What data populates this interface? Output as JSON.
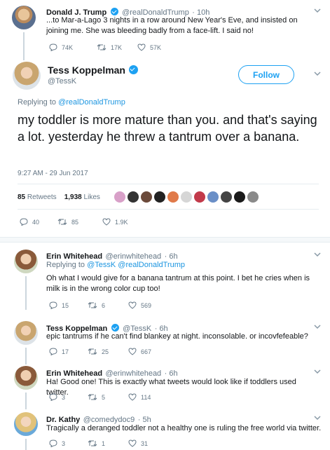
{
  "parent": {
    "name": "Donald J. Trump",
    "handle": "@realDonaldTrump",
    "time": "10h",
    "text": "...to Mar-a-Lago 3 nights in a row around New Year's Eve, and insisted on joining me. She was bleeding badly from a face-lift. I said no!",
    "replies": "74K",
    "retweets": "17K",
    "likes": "57K"
  },
  "main": {
    "name": "Tess Koppelman",
    "handle": "@TessK",
    "follow_label": "Follow",
    "replying_prefix": "Replying to ",
    "replying_to": "@realDonaldTrump",
    "text": "my toddler is more mature than you. and that's saying a lot. yesterday he threw a tantrum over a banana.",
    "timestamp": "9:27 AM - 29 Jun 2017",
    "retweet_count": "85",
    "retweet_word": "Retweets",
    "like_count": "1,938",
    "like_word": "Likes",
    "replies": "40",
    "retweets": "85",
    "likes": "1.9K"
  },
  "replies": [
    {
      "name": "Erin Whitehead",
      "handle": "@erinwhitehead",
      "time": "6h",
      "replying_prefix": "Replying to ",
      "replying_to": "@TessK @realDonaldTrump",
      "text": "Oh what I would give for a banana tantrum at this point. I bet he cries when is milk is in the wrong color cup too!",
      "replies": "15",
      "retweets": "6",
      "likes": "569"
    },
    {
      "name": "Tess Koppelman",
      "handle": "@TessK",
      "time": "6h",
      "text": "epic tantrums if he can't find blankey at night. inconsolable. or  incovfefeable?",
      "replies": "17",
      "retweets": "25",
      "likes": "667"
    },
    {
      "name": "Erin Whitehead",
      "handle": "@erinwhitehead",
      "time": "6h",
      "text": "Ha! Good one! This is exactly what tweets would look like if toddlers used twitter.",
      "replies": "3",
      "retweets": "5",
      "likes": "114"
    },
    {
      "name": "Dr. Kathy",
      "handle": "@comedydoc9",
      "time": "5h",
      "text": "Tragically a deranged toddler not a healthy one is ruling the free world via twitter.",
      "replies": "3",
      "retweets": "1",
      "likes": "31"
    }
  ],
  "colors": {
    "accent": "#1da1f2",
    "link": "#1b95e0",
    "muted": "#657786",
    "thread_line": "#ccd6dd"
  }
}
